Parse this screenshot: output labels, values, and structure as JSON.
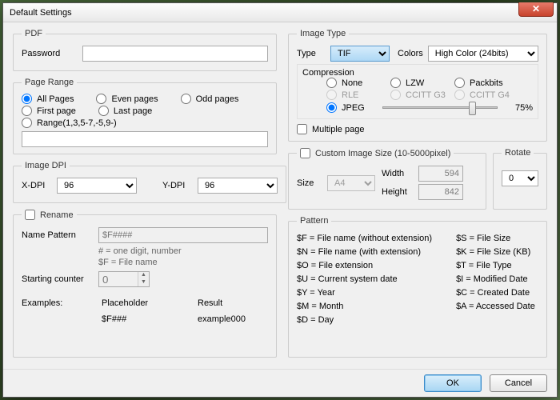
{
  "window": {
    "title": "Default Settings"
  },
  "pdf": {
    "legend": "PDF",
    "password_label": "Password",
    "password_value": ""
  },
  "pagerange": {
    "legend": "Page Range",
    "all": "All Pages",
    "even": "Even pages",
    "odd": "Odd pages",
    "first": "First page",
    "last": "Last page",
    "range": "Range(1,3,5-7,-5,9-)",
    "range_value": ""
  },
  "dpi": {
    "legend": "Image DPI",
    "x_label": "X-DPI",
    "x_value": "96",
    "y_label": "Y-DPI",
    "y_value": "96"
  },
  "rename": {
    "checkbox": "Rename",
    "pattern_label": "Name Pattern",
    "pattern_placeholder": "$F####",
    "hint1": "# = one digit, number",
    "hint2": "$F = File name",
    "counter_label": "Starting counter",
    "counter_value": "0",
    "examples_label": "Examples:",
    "col_placeholder": "Placeholder",
    "col_result": "Result",
    "ex_placeholder": "$F###",
    "ex_result": "example000"
  },
  "imagetype": {
    "legend": "Image Type",
    "type_label": "Type",
    "type_value": "TIF",
    "colors_label": "Colors",
    "colors_value": "High Color (24bits)",
    "compression_legend": "Compression",
    "comp": {
      "none": "None",
      "lzw": "LZW",
      "packbits": "Packbits",
      "rle": "RLE",
      "g3": "CCITT G3",
      "g4": "CCITT G4",
      "jpeg": "JPEG"
    },
    "jpeg_quality": "75%",
    "multipage": "Multiple page"
  },
  "customsize": {
    "checkbox": "Custom Image Size (10-5000pixel)",
    "size_label": "Size",
    "size_value": "A4",
    "width_label": "Width",
    "width_value": "594",
    "height_label": "Height",
    "height_value": "842"
  },
  "rotate": {
    "legend": "Rotate",
    "value": "0"
  },
  "pattern": {
    "legend": "Pattern",
    "colA": [
      "$F = File name (without extension)",
      "$N = File name (with extension)",
      "$O = File extension",
      "$U = Current system date",
      "$Y = Year",
      "$M = Month",
      "$D = Day"
    ],
    "colB": [
      "$S = File Size",
      "$K = File Size (KB)",
      "$T = File Type",
      "$I = Modified Date",
      "$C = Created Date",
      "$A = Accessed Date"
    ]
  },
  "buttons": {
    "ok": "OK",
    "cancel": "Cancel"
  }
}
